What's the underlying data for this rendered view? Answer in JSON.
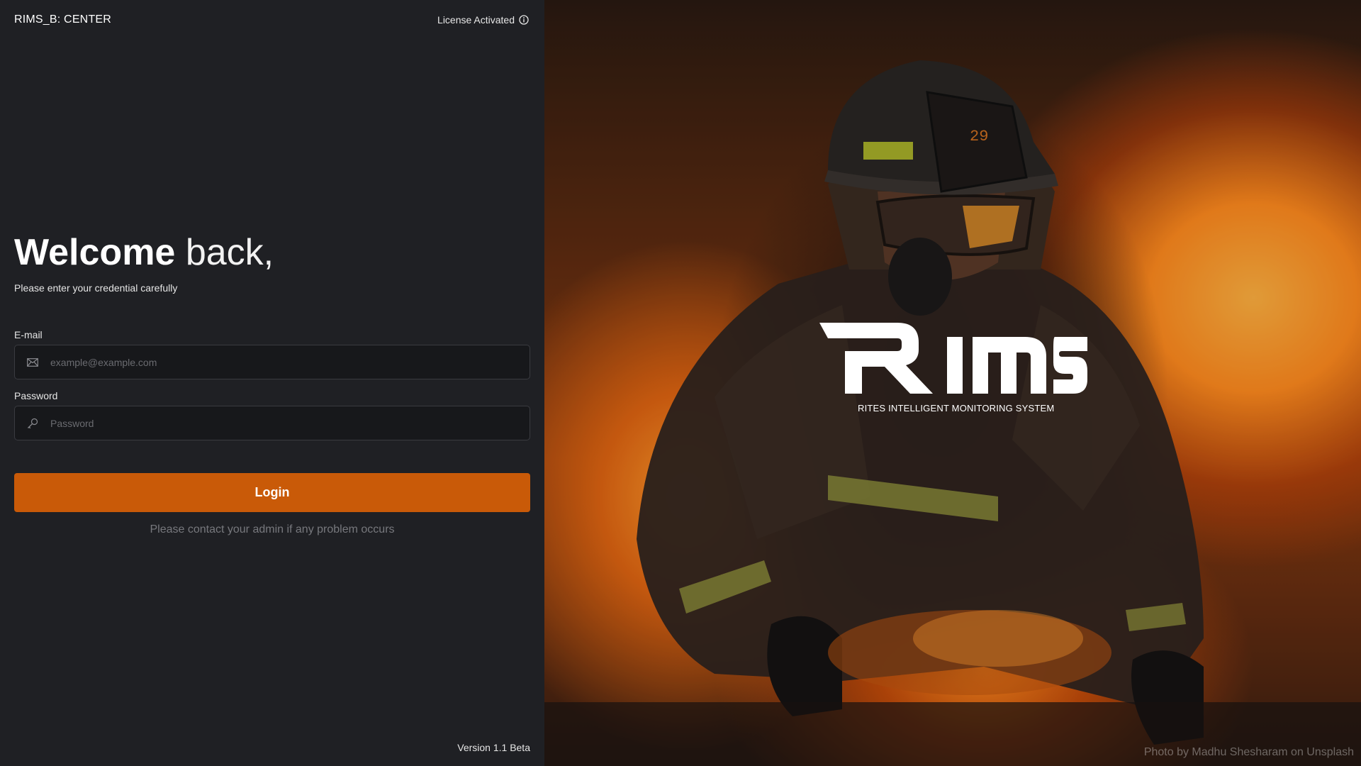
{
  "app": {
    "title": "RIMS_B: CENTER"
  },
  "license": {
    "label": "License Activated",
    "icon": "info-icon"
  },
  "welcome": {
    "bold": "Welcome",
    "light": "back,"
  },
  "subtitle": "Please enter your credential carefully",
  "form": {
    "email_label": "E-mail",
    "email_placeholder": "example@example.com",
    "email_value": "",
    "email_icon": "envelope-icon",
    "password_label": "Password",
    "password_placeholder": "Password",
    "password_value": "",
    "password_icon": "key-icon",
    "login_label": "Login"
  },
  "help_text": "Please contact your admin if any problem occurs",
  "version": "Version 1.1 Beta",
  "hero": {
    "logo_text": "RIMS",
    "tagline": "RITES INTELLIGENT MONITORING SYSTEM",
    "helmet_number": "29",
    "credit": "Photo by Madhu Shesharam on Unsplash"
  },
  "colors": {
    "panel_bg": "#1f2024",
    "input_bg": "#17181b",
    "accent": "#c95a08"
  }
}
